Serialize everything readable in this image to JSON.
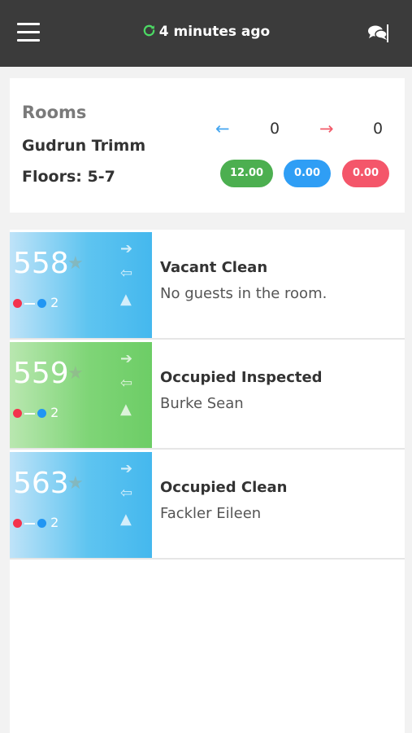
{
  "header": {
    "sync_text": "4 minutes ago",
    "menu_icon": "hamburger-menu-icon",
    "sync_icon": "refresh-icon",
    "chat_icon": "chat-bubbles-icon"
  },
  "summary": {
    "title": "Rooms",
    "attendant": "Gudrun Trimm",
    "floors": "Floors: 5-7",
    "arrivals_count": "0",
    "departures_count": "0",
    "credits": [
      "12.00",
      "0.00",
      "0.00"
    ],
    "colors": {
      "green": "#4caf50",
      "blue": "#2f9ef5",
      "red": "#f4566a"
    }
  },
  "rooms": [
    {
      "number": "558",
      "status": "Vacant Clean",
      "detail": "No guests in the room.",
      "dots_count": "2",
      "panel_color": "#45b8ee"
    },
    {
      "number": "559",
      "status": "Occupied Inspected",
      "detail": "Burke Sean",
      "dots_count": "2",
      "panel_color": "#6dcd66"
    },
    {
      "number": "563",
      "status": "Occupied Clean",
      "detail": "Fackler Eileen",
      "dots_count": "2",
      "panel_color": "#45b8ee"
    }
  ]
}
